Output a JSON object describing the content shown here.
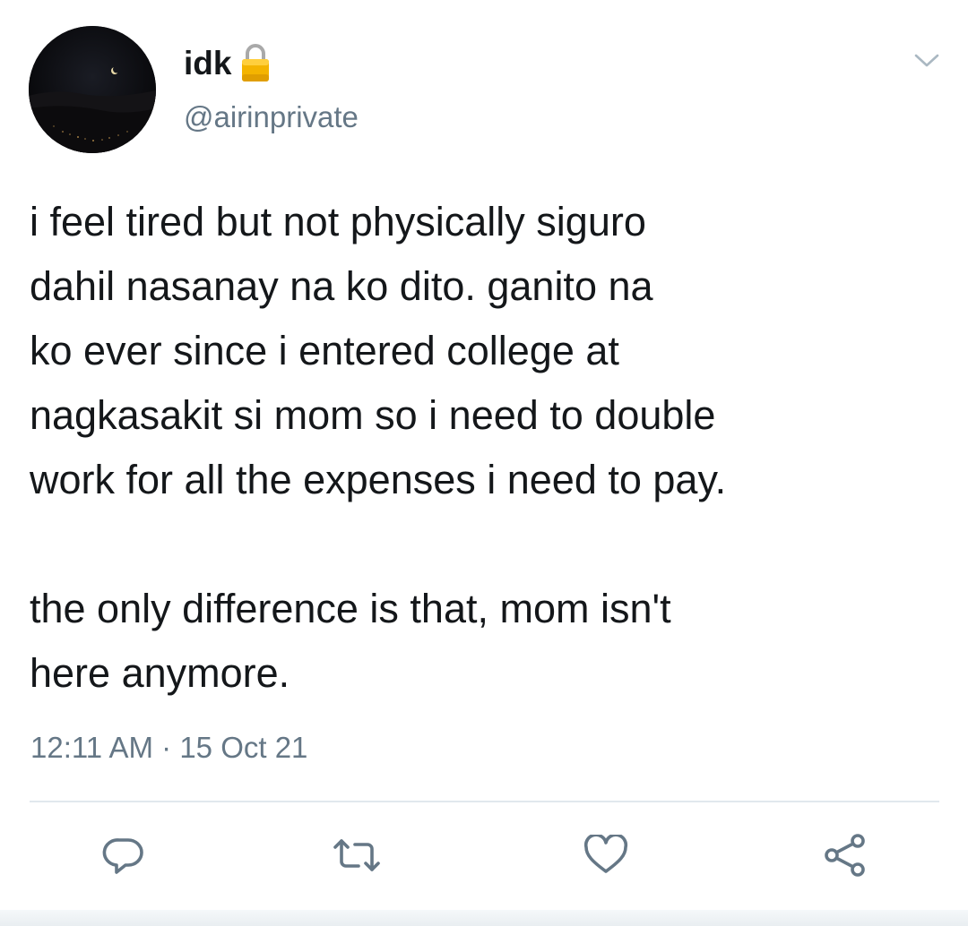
{
  "tweet": {
    "author": {
      "display_name": "idk",
      "handle": "@airinprivate",
      "verified_icon": "lock-icon",
      "avatar": "night-sky-crescent-moon-avatar"
    },
    "text_lines": [
      "i feel tired but not physically siguro",
      "dahil nasanay na ko dito. ganito na",
      "ko ever since i entered college at",
      "nagkasakit si mom so i need to double",
      "work for all the expenses i need to pay.",
      "the only difference is that, mom isn't",
      "here anymore."
    ],
    "time": "12:11 AM",
    "separator": "·",
    "date": "15 Oct 21",
    "menu_icon": "chevron-down-icon",
    "actions": [
      "reply-icon",
      "retweet-icon",
      "like-icon",
      "share-icon"
    ]
  },
  "colors": {
    "text": "#14171a",
    "secondary": "#657786",
    "divider": "#e1e8ed",
    "lock_gold": "#f4b400"
  }
}
